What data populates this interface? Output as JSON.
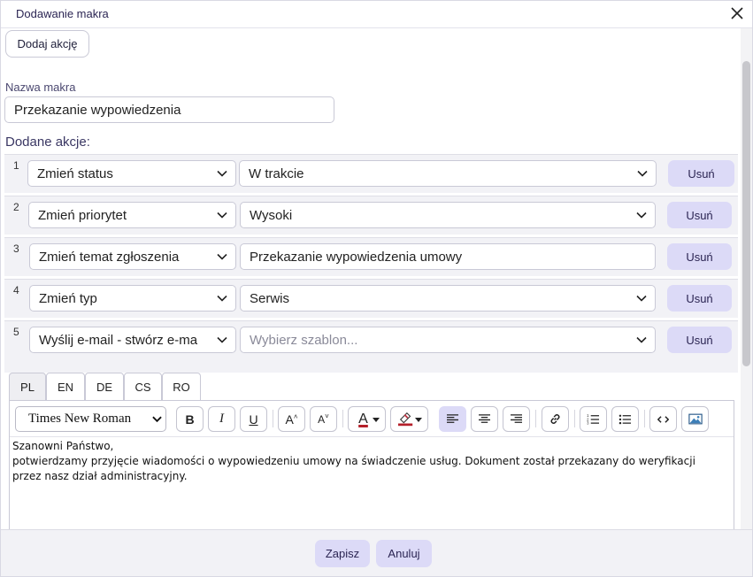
{
  "dialog": {
    "title": "Dodawanie makra",
    "close_icon": "close-icon"
  },
  "add_action_label": "Dodaj akcję",
  "macro_name": {
    "label": "Nazwa makra",
    "value": "Przekazanie wypowiedzenia"
  },
  "actions_label": "Dodane akcje:",
  "actions": [
    {
      "num": "1",
      "type": "Zmień status",
      "value": "W trakcie",
      "value_is_placeholder": false,
      "value_kind": "select",
      "remove": "Usuń"
    },
    {
      "num": "2",
      "type": "Zmień priorytet",
      "value": "Wysoki",
      "value_is_placeholder": false,
      "value_kind": "select",
      "remove": "Usuń"
    },
    {
      "num": "3",
      "type": "Zmień temat zgłoszenia",
      "value": "Przekazanie wypowiedzenia umowy",
      "value_is_placeholder": false,
      "value_kind": "input",
      "remove": "Usuń"
    },
    {
      "num": "4",
      "type": "Zmień typ",
      "value": "Serwis",
      "value_is_placeholder": false,
      "value_kind": "select",
      "remove": "Usuń"
    },
    {
      "num": "5",
      "type": "Wyślij e-mail - stwórz e-ma",
      "value": "Wybierz szablon...",
      "value_is_placeholder": true,
      "value_kind": "select",
      "remove": "Usuń"
    }
  ],
  "language_tabs": [
    "PL",
    "EN",
    "DE",
    "CS",
    "RO"
  ],
  "active_tab": "PL",
  "editor": {
    "font": "Times New Roman",
    "toolbar_icons": [
      "bold-icon",
      "italic-icon",
      "underline-icon",
      "font-size-increase-icon",
      "font-size-decrease-icon",
      "font-color-icon",
      "highlight-color-icon",
      "align-left-icon",
      "align-center-icon",
      "align-right-icon",
      "link-icon",
      "ordered-list-icon",
      "unordered-list-icon",
      "code-view-icon",
      "image-icon"
    ],
    "bold_glyph": "B",
    "italic_glyph": "I",
    "underline_glyph": "U",
    "increase_glyph": "A",
    "decrease_glyph": "A",
    "color_glyph": "A",
    "accent_color": "#b5202a",
    "lines": [
      "Szanowni Państwo,",
      "potwierdzamy przyjęcie wiadomości o wypowiedzeniu umowy na świadczenie usług. Dokument został przekazany do weryfikacji przez nasz dział administracyjny."
    ]
  },
  "footer": {
    "save": "Zapisz",
    "cancel": "Anuluj"
  },
  "colors": {
    "accent_button": "#dcdaf7",
    "row_background": "#f2f2f6"
  }
}
